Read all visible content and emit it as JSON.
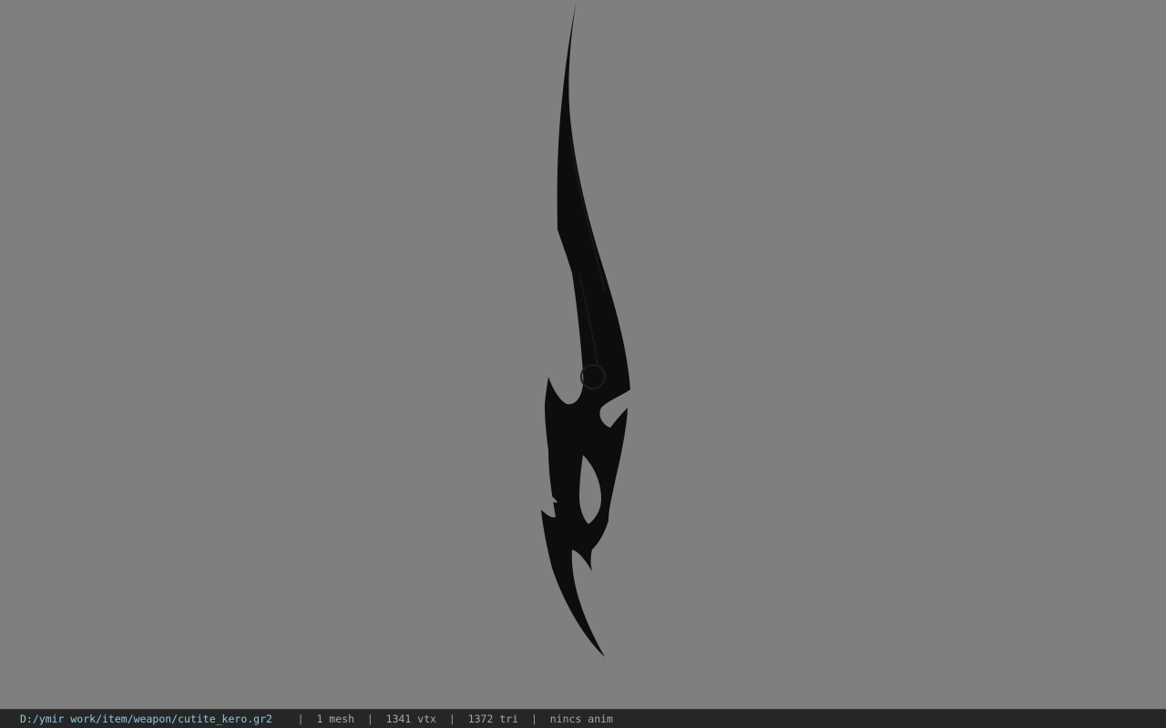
{
  "viewer": {
    "background_color": "#7f7f7f",
    "model_color": "#0d0d0d",
    "model_icon": "curved-blade-model"
  },
  "status_bar": {
    "file_path": "D:/ymir work/item/weapon/cutite_kero.gr2",
    "separator": "|",
    "mesh_count": "1 mesh",
    "vertex_count": "1341 vtx",
    "triangle_count": "1372 tri",
    "animation": "nincs anim"
  }
}
